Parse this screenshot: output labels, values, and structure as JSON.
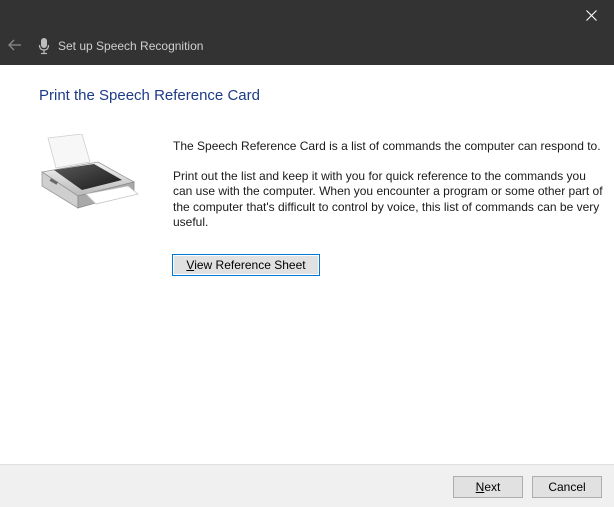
{
  "window": {
    "title": "Set up Speech Recognition",
    "close_icon": "close-icon",
    "back_icon": "back-arrow-icon",
    "app_icon": "microphone-icon"
  },
  "page": {
    "heading": "Print the Speech Reference Card",
    "illustration": "printer-icon",
    "paragraph1": "The Speech Reference Card is a list of commands the computer can respond to.",
    "paragraph2": "Print out the list and keep it with you for quick reference to the commands you can use with the computer. When you encounter a program or some other part of the computer that's difficult to control by voice, this list of commands can be very useful.",
    "button": {
      "accel": "V",
      "rest": "iew Reference Sheet"
    }
  },
  "footer": {
    "next": {
      "accel": "N",
      "rest": "ext"
    },
    "cancel": "Cancel"
  },
  "colors": {
    "titlebar": "#333333",
    "heading": "#1c3c87",
    "focus_border": "#0078d7",
    "footer": "#f0f0f0"
  }
}
